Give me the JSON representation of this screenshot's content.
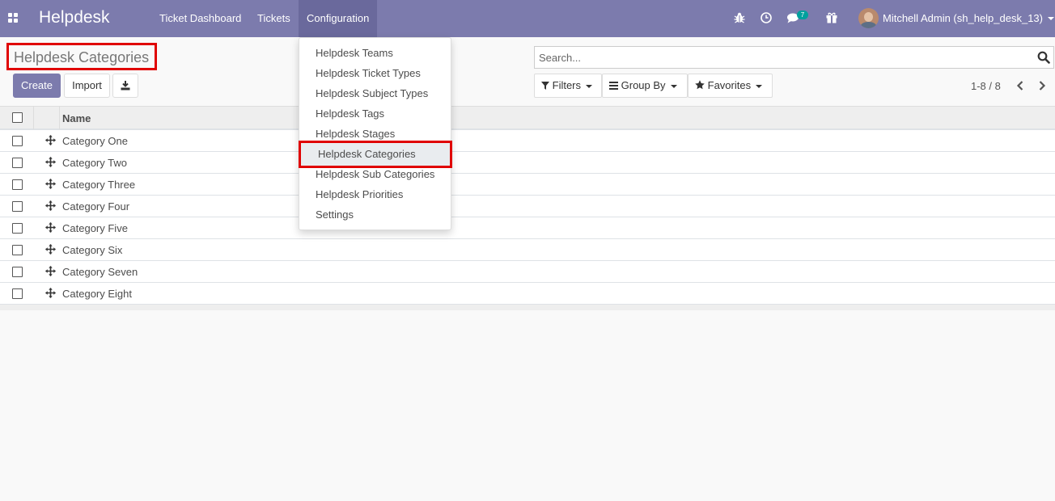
{
  "navbar": {
    "app_name": "Helpdesk",
    "menu": [
      "Ticket Dashboard",
      "Tickets",
      "Configuration"
    ],
    "active_menu": "Configuration",
    "messages_badge": "7",
    "user_name": "Mitchell Admin (sh_help_desk_13)",
    "icons": [
      "apps-grid-icon",
      "bug-icon",
      "clock-icon",
      "chat-icon",
      "gift-icon"
    ],
    "accent_color": "#7c7bad"
  },
  "control_panel": {
    "title": "Helpdesk Categories",
    "create_label": "Create",
    "import_label": "Import",
    "search_placeholder": "Search...",
    "filters_label": "Filters",
    "group_by_label": "Group By",
    "favorites_label": "Favorites",
    "pager": "1-8 / 8"
  },
  "list": {
    "column_name": "Name",
    "rows": [
      "Category One",
      "Category Two",
      "Category Three",
      "Category Four",
      "Category Five",
      "Category Six",
      "Category Seven",
      "Category Eight"
    ]
  },
  "config_menu": {
    "items": [
      "Helpdesk Teams",
      "Helpdesk Ticket Types",
      "Helpdesk Subject Types",
      "Helpdesk Tags",
      "Helpdesk Stages",
      "Helpdesk Categories",
      "Helpdesk Sub Categories",
      "Helpdesk Priorities",
      "Settings"
    ],
    "selected": "Helpdesk Categories"
  }
}
